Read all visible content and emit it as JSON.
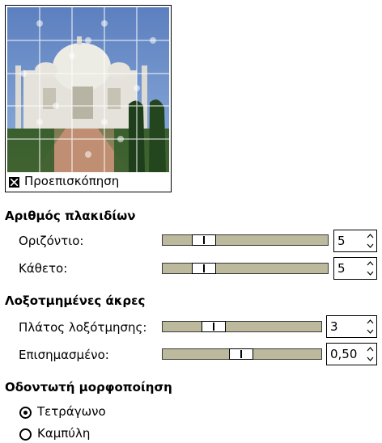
{
  "preview": {
    "checkbox_label": "Προεπισκόπηση",
    "checked": true
  },
  "tiles": {
    "title": "Αριθμός πλακιδίων",
    "horizontal": {
      "label": "Οριζόντιο:",
      "value": "5",
      "fraction": 0.12
    },
    "vertical": {
      "label": "Κάθετο:",
      "value": "5",
      "fraction": 0.12
    }
  },
  "bevel": {
    "title": "Λοξοτμημένες άκρες",
    "width": {
      "label": "Πλάτος λοξότμησης:",
      "value": "3",
      "fraction": 0.25
    },
    "highlight": {
      "label": "Επισημασμένο:",
      "value": "0,50",
      "fraction": 0.5
    }
  },
  "jigsaw_style": {
    "title": "Οδοντωτή μορφοποίηση",
    "options": [
      {
        "label": "Τετράγωνο",
        "selected": true
      },
      {
        "label": "Καμπύλη",
        "selected": false
      }
    ]
  }
}
